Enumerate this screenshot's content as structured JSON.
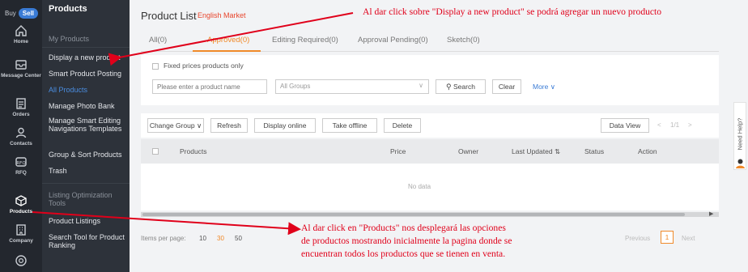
{
  "rail": {
    "buy": "Buy",
    "sell": "Sell",
    "items": [
      {
        "label": "Home",
        "icon": "home-icon"
      },
      {
        "label": "Message Center",
        "icon": "message-icon"
      },
      {
        "label": "Orders",
        "icon": "orders-icon"
      },
      {
        "label": "Contacts",
        "icon": "contacts-icon"
      },
      {
        "label": "RFQ",
        "icon": "rfq-icon"
      },
      {
        "label": "Products",
        "icon": "products-icon"
      },
      {
        "label": "Company",
        "icon": "company-icon"
      },
      {
        "label": "",
        "icon": "more-icon"
      }
    ]
  },
  "submenu": {
    "title": "Products",
    "items": [
      "My Products",
      "Display a new product",
      "Smart Product Posting",
      "All Products",
      "Manage Photo Bank",
      "Manage Smart Editing Navigations Templates",
      "Group & Sort Products",
      "Trash",
      "Listing Optimization Tools",
      "Product Listings",
      "Search Tool for Product Ranking"
    ]
  },
  "main": {
    "title": "Product List",
    "market": "English Market",
    "tabs": [
      "All(0)",
      "Approved(0)",
      "Editing Required(0)",
      "Approval Pending(0)",
      "Sketch(0)"
    ],
    "filter": {
      "checkbox_label": "Fixed prices products only",
      "product_placeholder": "Please enter a product name",
      "groups_placeholder": "All Groups",
      "search_label": "Search",
      "clear_label": "Clear",
      "more_label": "More"
    },
    "toolbar": {
      "change_group": "Change Group",
      "refresh": "Refresh",
      "display_online": "Display online",
      "take_offline": "Take offline",
      "delete": "Delete",
      "data_view": "Data View",
      "page_indicator": "1/1"
    },
    "table": {
      "headers": [
        "Products",
        "Price",
        "Owner",
        "Last Updated",
        "Status",
        "Action"
      ],
      "empty": "No data"
    },
    "pagination": {
      "per_page_label": "Items per page:",
      "options": [
        "10",
        "30",
        "50"
      ],
      "selected": "30",
      "previous": "Previous",
      "current": "1",
      "next": "Next"
    },
    "help": "Need Help?"
  },
  "annotations": {
    "top": "Al dar click sobre \"Display a new product\" se podrá agregar un nuevo producto",
    "bottom_lines": [
      "Al dar click en \"Products\" nos desplegará las opciones",
      "de productos mostrando inicialmente la pagina donde se",
      "encuentran todos los productos que se tienen en venta."
    ],
    "color": "#e0001a"
  }
}
